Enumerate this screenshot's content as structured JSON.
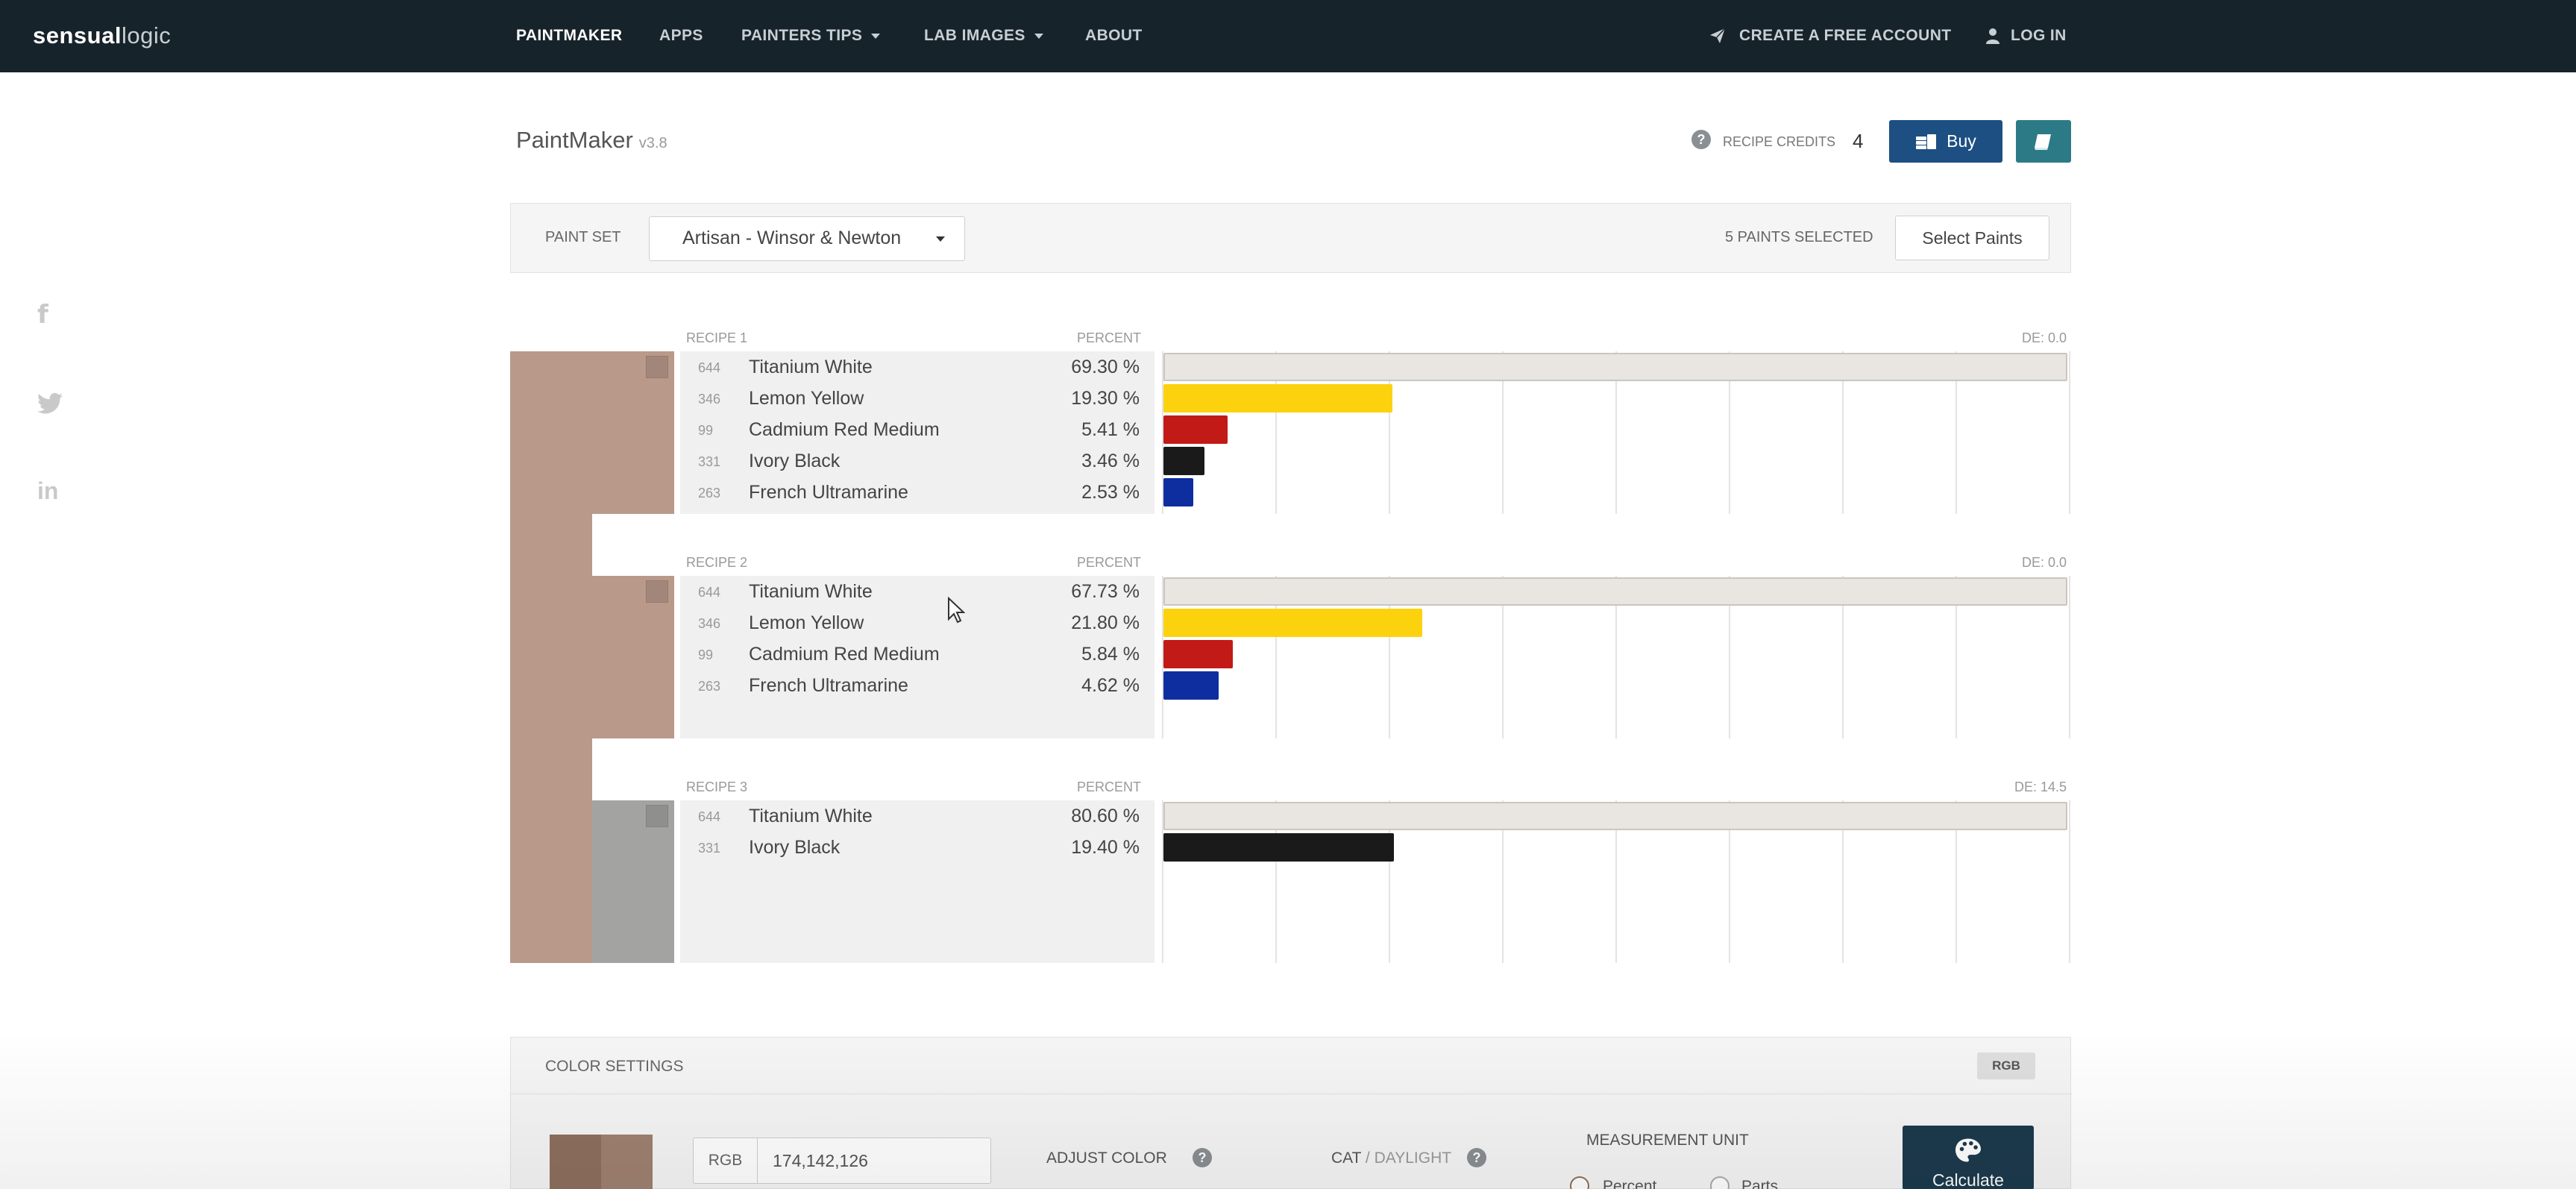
{
  "nav": {
    "logo_bold": "sensual",
    "logo_light": "logic",
    "items": [
      {
        "label": "PAINTMAKER",
        "active": true
      },
      {
        "label": "APPS"
      },
      {
        "label": "PAINTERS TIPS"
      },
      {
        "label": "LAB IMAGES"
      },
      {
        "label": "ABOUT"
      }
    ],
    "create_account": "CREATE A FREE ACCOUNT",
    "login": "LOG IN"
  },
  "header": {
    "title": "PaintMaker",
    "version": "v3.8",
    "credits_label": "RECIPE CREDITS",
    "credits_value": "4",
    "buy_label": "Buy"
  },
  "paint_set": {
    "label": "PAINT SET",
    "selected": "Artisan - Winsor & Newton",
    "paints_selected": "5 PAINTS SELECTED",
    "select_button": "Select Paints"
  },
  "recipes": [
    {
      "title": "RECIPE 1",
      "percent_label": "PERCENT",
      "de": "DE: 0.0",
      "mix_color": "#b9998a",
      "paints": [
        {
          "code": "644",
          "name": "Titanium White",
          "percent": "69.30 %",
          "value": 69.3,
          "color": "#e9e6e1"
        },
        {
          "code": "346",
          "name": "Lemon Yellow",
          "percent": "19.30 %",
          "value": 19.3,
          "color": "#fcd20f"
        },
        {
          "code": "99",
          "name": "Cadmium Red Medium",
          "percent": "5.41 %",
          "value": 5.41,
          "color": "#c11a17"
        },
        {
          "code": "331",
          "name": "Ivory Black",
          "percent": "3.46 %",
          "value": 3.46,
          "color": "#1a1a1a"
        },
        {
          "code": "263",
          "name": "French Ultramarine",
          "percent": "2.53 %",
          "value": 2.53,
          "color": "#0e2ea0"
        }
      ]
    },
    {
      "title": "RECIPE 2",
      "percent_label": "PERCENT",
      "de": "DE: 0.0",
      "mix_color": "#b9998a",
      "paints": [
        {
          "code": "644",
          "name": "Titanium White",
          "percent": "67.73 %",
          "value": 67.73,
          "color": "#e9e6e1"
        },
        {
          "code": "346",
          "name": "Lemon Yellow",
          "percent": "21.80 %",
          "value": 21.8,
          "color": "#fcd20f"
        },
        {
          "code": "99",
          "name": "Cadmium Red Medium",
          "percent": "5.84 %",
          "value": 5.84,
          "color": "#c11a17"
        },
        {
          "code": "263",
          "name": "French Ultramarine",
          "percent": "4.62 %",
          "value": 4.62,
          "color": "#0e2ea0"
        }
      ]
    },
    {
      "title": "RECIPE 3",
      "percent_label": "PERCENT",
      "de": "DE: 14.5",
      "mix_color": "#a3a4a2",
      "paints": [
        {
          "code": "644",
          "name": "Titanium White",
          "percent": "80.60 %",
          "value": 80.6,
          "color": "#e9e6e1"
        },
        {
          "code": "331",
          "name": "Ivory Black",
          "percent": "19.40 %",
          "value": 19.4,
          "color": "#1a1a1a"
        }
      ]
    }
  ],
  "target_color": "#b9998a",
  "settings": {
    "title": "COLOR SETTINGS",
    "badge": "RGB",
    "rgb_label": "RGB",
    "rgb_value": "174,142,126",
    "adjust_color": "ADJUST COLOR",
    "cat_label": "CAT",
    "daylight_label": "DAYLIGHT",
    "measurement_unit": "MEASUREMENT UNIT",
    "unit_percent": "Percent",
    "unit_parts": "Parts",
    "calculate": "Calculate",
    "swatch_colors": [
      "#8e6f5e",
      "#9f8170"
    ]
  }
}
